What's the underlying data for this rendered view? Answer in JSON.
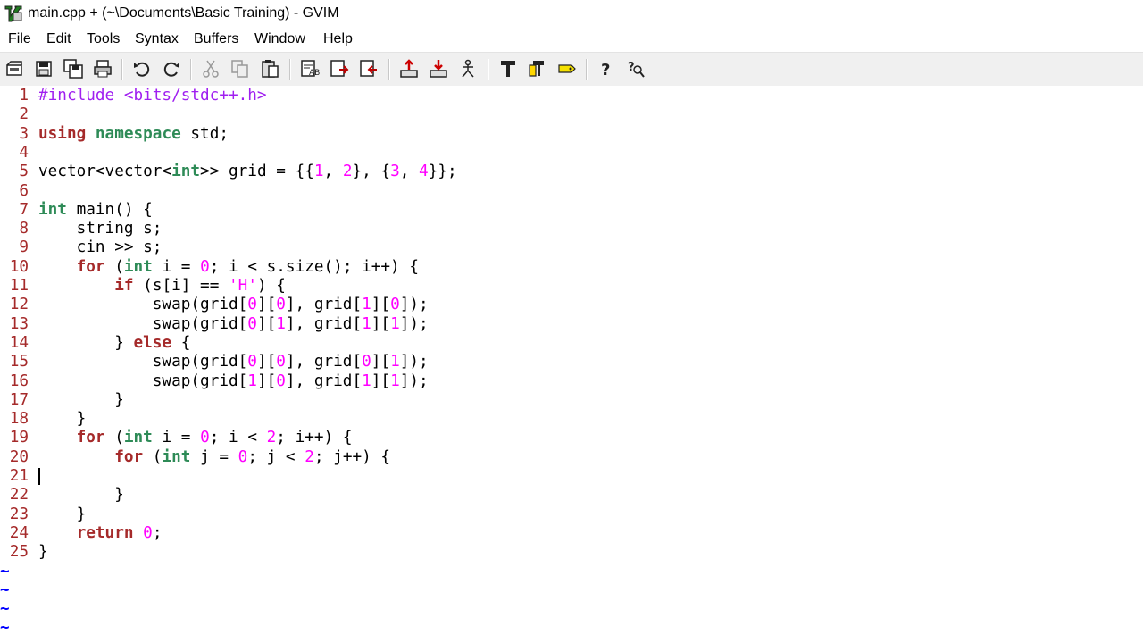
{
  "window": {
    "title": "main.cpp + (~\\Documents\\Basic Training) - GVIM"
  },
  "menu": [
    {
      "label": "File",
      "name": "menu-file"
    },
    {
      "label": "Edit",
      "name": "menu-edit"
    },
    {
      "label": "Tools",
      "name": "menu-tools"
    },
    {
      "label": "Syntax",
      "name": "menu-syntax"
    },
    {
      "label": "Buffers",
      "name": "menu-buffers"
    },
    {
      "label": "Window",
      "name": "menu-window"
    },
    {
      "label": "Help",
      "name": "menu-help"
    }
  ],
  "toolbar": [
    "open-file-icon",
    "save-icon",
    "save-all-icon",
    "print-icon",
    "undo-icon",
    "redo-icon",
    "cut-icon",
    "copy-icon",
    "paste-icon",
    "find-replace-icon",
    "find-next-icon",
    "find-previous-icon",
    "load-session-icon",
    "save-session-icon",
    "run-script-icon",
    "make-icon",
    "run-ctags-icon",
    "jump-to-tag-icon",
    "help-icon",
    "find-help-icon"
  ],
  "editor": {
    "lines": [
      [
        {
          "t": "#include <bits/stdc++.h>",
          "c": "pp"
        }
      ],
      [],
      [
        {
          "t": "using",
          "c": "kw"
        },
        {
          "t": " "
        },
        {
          "t": "namespace",
          "c": "ty"
        },
        {
          "t": " std;"
        }
      ],
      [],
      [
        {
          "t": "vector<vector<"
        },
        {
          "t": "int",
          "c": "ty"
        },
        {
          "t": ">> grid = {{"
        },
        {
          "t": "1",
          "c": "num"
        },
        {
          "t": ", "
        },
        {
          "t": "2",
          "c": "num"
        },
        {
          "t": "}, {"
        },
        {
          "t": "3",
          "c": "num"
        },
        {
          "t": ", "
        },
        {
          "t": "4",
          "c": "num"
        },
        {
          "t": "}};"
        }
      ],
      [],
      [
        {
          "t": "int",
          "c": "ty"
        },
        {
          "t": " main() {"
        }
      ],
      [
        {
          "t": "    string s;"
        }
      ],
      [
        {
          "t": "    cin >> s;"
        }
      ],
      [
        {
          "t": "    "
        },
        {
          "t": "for",
          "c": "kw"
        },
        {
          "t": " ("
        },
        {
          "t": "int",
          "c": "ty"
        },
        {
          "t": " i = "
        },
        {
          "t": "0",
          "c": "num"
        },
        {
          "t": "; i < s.size(); i++) {"
        }
      ],
      [
        {
          "t": "        "
        },
        {
          "t": "if",
          "c": "kw"
        },
        {
          "t": " (s[i] == "
        },
        {
          "t": "'H'",
          "c": "str"
        },
        {
          "t": ") {"
        }
      ],
      [
        {
          "t": "            swap(grid["
        },
        {
          "t": "0",
          "c": "num"
        },
        {
          "t": "]["
        },
        {
          "t": "0",
          "c": "num"
        },
        {
          "t": "], grid["
        },
        {
          "t": "1",
          "c": "num"
        },
        {
          "t": "]["
        },
        {
          "t": "0",
          "c": "num"
        },
        {
          "t": "]);"
        }
      ],
      [
        {
          "t": "            swap(grid["
        },
        {
          "t": "0",
          "c": "num"
        },
        {
          "t": "]["
        },
        {
          "t": "1",
          "c": "num"
        },
        {
          "t": "], grid["
        },
        {
          "t": "1",
          "c": "num"
        },
        {
          "t": "]["
        },
        {
          "t": "1",
          "c": "num"
        },
        {
          "t": "]);"
        }
      ],
      [
        {
          "t": "        } "
        },
        {
          "t": "else",
          "c": "kw"
        },
        {
          "t": " {"
        }
      ],
      [
        {
          "t": "            swap(grid["
        },
        {
          "t": "0",
          "c": "num"
        },
        {
          "t": "]["
        },
        {
          "t": "0",
          "c": "num"
        },
        {
          "t": "], grid["
        },
        {
          "t": "0",
          "c": "num"
        },
        {
          "t": "]["
        },
        {
          "t": "1",
          "c": "num"
        },
        {
          "t": "]);"
        }
      ],
      [
        {
          "t": "            swap(grid["
        },
        {
          "t": "1",
          "c": "num"
        },
        {
          "t": "]["
        },
        {
          "t": "0",
          "c": "num"
        },
        {
          "t": "], grid["
        },
        {
          "t": "1",
          "c": "num"
        },
        {
          "t": "]["
        },
        {
          "t": "1",
          "c": "num"
        },
        {
          "t": "]);"
        }
      ],
      [
        {
          "t": "        }"
        }
      ],
      [
        {
          "t": "    }"
        }
      ],
      [
        {
          "t": "    "
        },
        {
          "t": "for",
          "c": "kw"
        },
        {
          "t": " ("
        },
        {
          "t": "int",
          "c": "ty"
        },
        {
          "t": " i = "
        },
        {
          "t": "0",
          "c": "num"
        },
        {
          "t": "; i < "
        },
        {
          "t": "2",
          "c": "num"
        },
        {
          "t": "; i++) {"
        }
      ],
      [
        {
          "t": "        "
        },
        {
          "t": "for",
          "c": "kw"
        },
        {
          "t": " ("
        },
        {
          "t": "int",
          "c": "ty"
        },
        {
          "t": " j = "
        },
        {
          "t": "0",
          "c": "num"
        },
        {
          "t": "; j < "
        },
        {
          "t": "2",
          "c": "num"
        },
        {
          "t": "; j++) {"
        }
      ],
      [],
      [
        {
          "t": "        }"
        }
      ],
      [
        {
          "t": "    }"
        }
      ],
      [
        {
          "t": "    "
        },
        {
          "t": "return",
          "c": "kw"
        },
        {
          "t": " "
        },
        {
          "t": "0",
          "c": "num"
        },
        {
          "t": ";"
        }
      ],
      [
        {
          "t": "}"
        }
      ]
    ],
    "tilde": "~",
    "cursor_line": 21
  }
}
